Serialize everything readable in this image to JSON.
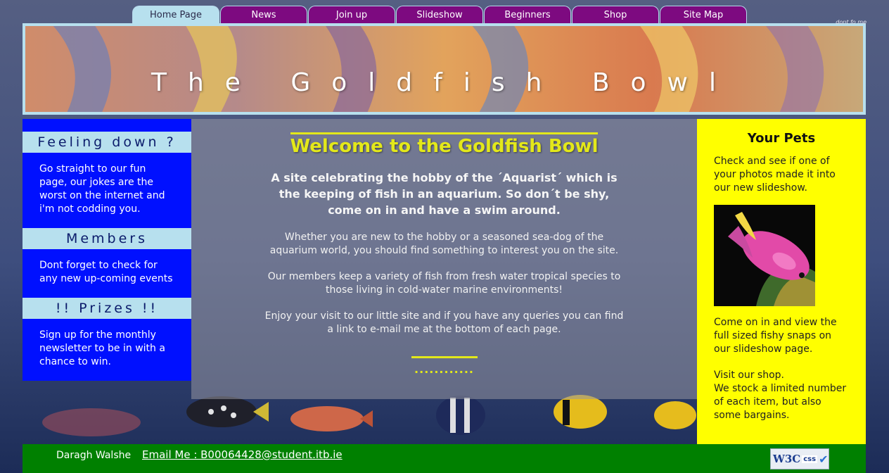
{
  "nav": {
    "tabs": [
      {
        "label": "Home Page",
        "active": true
      },
      {
        "label": "News"
      },
      {
        "label": "Join up"
      },
      {
        "label": "Slideshow"
      },
      {
        "label": "Beginners"
      },
      {
        "label": "Shop"
      },
      {
        "label": "Site Map"
      }
    ]
  },
  "banner": {
    "title": "The Goldfish Bowl",
    "credit": "dont fo me"
  },
  "sidebar": {
    "boxes": [
      {
        "heading": "Feeling down ?",
        "text": "Go straight to our fun page, our jokes are the worst on the internet and i'm not codding you."
      },
      {
        "heading": "Members",
        "text": "Dont forget to check for any new up-coming events"
      },
      {
        "heading": "!! Prizes !!",
        "text": "Sign up for the monthly newsletter to be in with a chance to win."
      }
    ]
  },
  "main": {
    "welcome": "Welcome to the Goldfish Bowl",
    "intro": "A site celebrating the hobby of the ´Aquarist´ which is the keeping of fish in an aquarium. So don´t be shy, come on in and have a swim around.",
    "paragraphs": [
      "Whether you are new to the hobby or a seasoned sea-dog of the aquarium world, you should find something to interest you on the site.",
      "Our members keep a variety of fish from fresh water tropical species to those living in cold-water marine environments!",
      "Enjoy your visit to our little site and if you have any queries you can find a link to e-mail me at the bottom of each page."
    ],
    "dots": "............"
  },
  "pets": {
    "title": "Your Pets",
    "text1": "Check and see if one of your photos made it into our new slideshow.",
    "text2": "Come on in and view the full sized fishy snaps on our slideshow page.",
    "text3": "Visit our shop.",
    "text4": "We stock a limited number of each item, but also some bargains."
  },
  "footer": {
    "author": "Daragh Walshe",
    "email": "Email Me : B00064428@student.itb.ie",
    "badge_w3c": "W3C",
    "badge_css": "css",
    "badge_tick": "✔"
  },
  "colors": {
    "tab": "#7d0a80",
    "tab_active": "#b7e0ee",
    "sidebar": "#0010ff",
    "pets": "#ffff00",
    "footer": "#008000",
    "accent": "#e3e81a"
  }
}
